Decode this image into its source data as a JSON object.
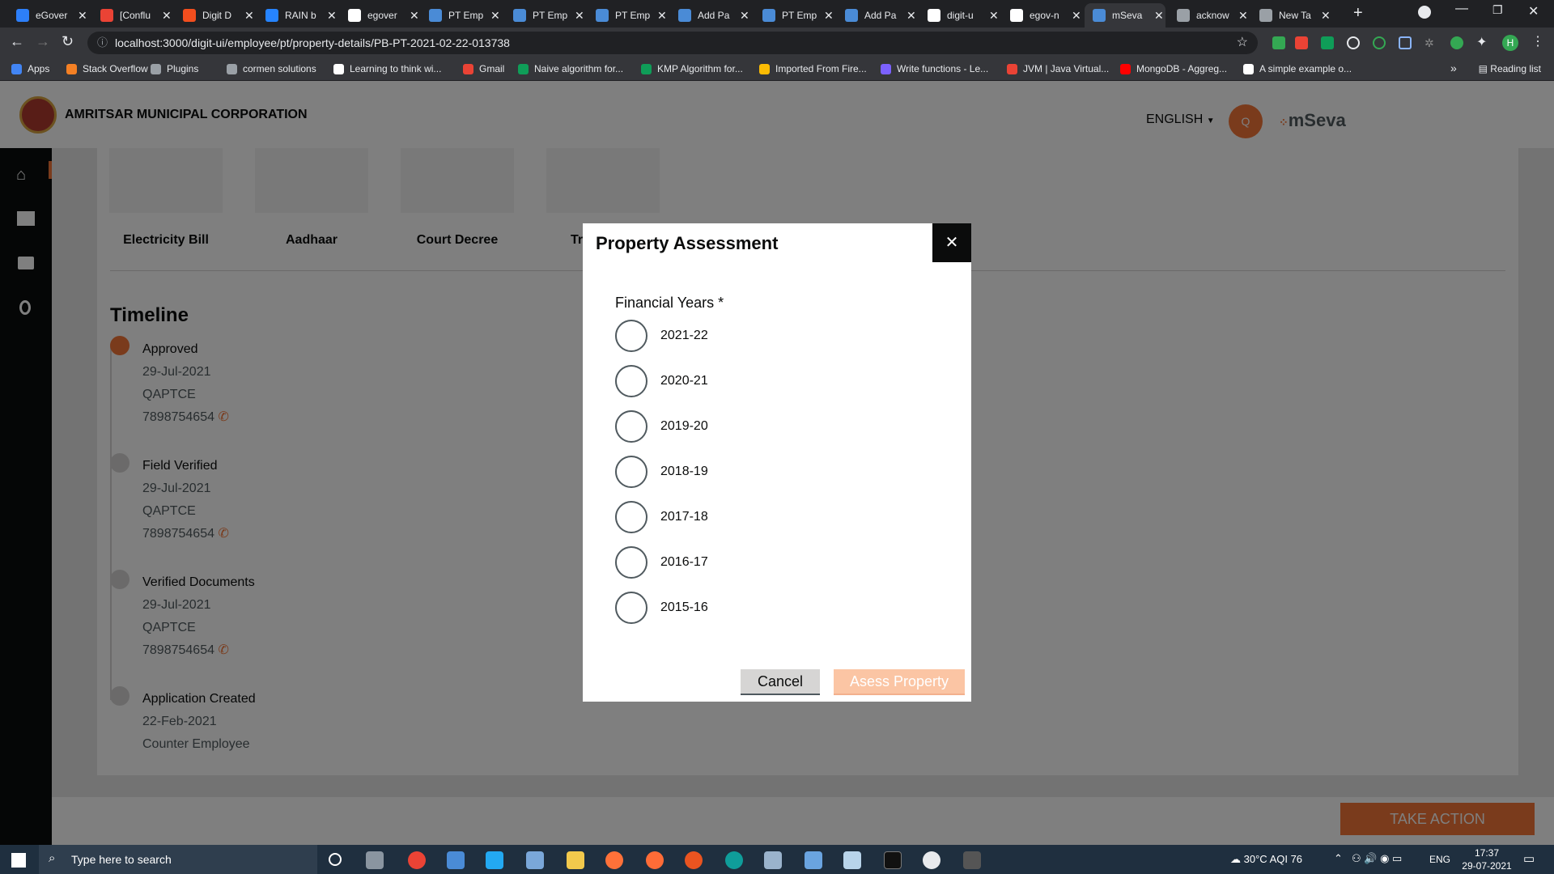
{
  "browser": {
    "tabs": [
      {
        "title": "eGover",
        "color": "#2d7ff9"
      },
      {
        "title": "[Conflu",
        "color": "#ea4335"
      },
      {
        "title": "Digit D",
        "color": "#f24e1e"
      },
      {
        "title": "RAIN b",
        "color": "#2684ff"
      },
      {
        "title": "egover",
        "color": "#ffffff"
      },
      {
        "title": "PT Emp",
        "color": "#4a8bd6"
      },
      {
        "title": "PT Emp",
        "color": "#4a8bd6"
      },
      {
        "title": "PT Emp",
        "color": "#4a8bd6"
      },
      {
        "title": "Add Pa",
        "color": "#4a8bd6"
      },
      {
        "title": "PT Emp",
        "color": "#4a8bd6"
      },
      {
        "title": "Add Pa",
        "color": "#4a8bd6"
      },
      {
        "title": "digit-u",
        "color": "#ffffff"
      },
      {
        "title": "egov-n",
        "color": "#ffffff"
      },
      {
        "title": "mSeva",
        "color": "#4a8bd6"
      },
      {
        "title": "acknow",
        "color": "#9aa0a6"
      },
      {
        "title": "New Ta",
        "color": "#9aa0a6"
      }
    ],
    "close_glyph": "✕",
    "new_tab_glyph": "+",
    "url": "localhost:3000/digit-ui/employee/pt/property-details/PB-PT-2021-02-22-013738",
    "bookmarks": [
      {
        "label": "Apps",
        "color": "#4285f4"
      },
      {
        "label": "Stack Overflow",
        "color": "#f48024"
      },
      {
        "label": "Plugins",
        "color": "#9aa0a6"
      },
      {
        "label": "cormen solutions",
        "color": "#9aa0a6"
      },
      {
        "label": "Learning to think wi...",
        "color": "#ffffff"
      },
      {
        "label": "Gmail",
        "color": "#ea4335"
      },
      {
        "label": "Naive algorithm for...",
        "color": "#0f9d58"
      },
      {
        "label": "KMP Algorithm for...",
        "color": "#0f9d58"
      },
      {
        "label": "Imported From Fire...",
        "color": "#fbbc04"
      },
      {
        "label": "Write functions - Le...",
        "color": "#7b61ff"
      },
      {
        "label": "JVM | Java Virtual...",
        "color": "#ea4335"
      },
      {
        "label": "MongoDB - Aggreg...",
        "color": "#ff0000"
      },
      {
        "label": "A simple example o...",
        "color": "#ffffff"
      }
    ],
    "overflow_glyph": "»",
    "reading_list": "Reading list"
  },
  "app": {
    "org_name": "AMRITSAR MUNICIPAL CORPORATION",
    "language": "ENGLISH",
    "avatar_initial": "Q",
    "brand": "mSeva",
    "accent": "#f47738",
    "documents": [
      "Electricity Bill",
      "Aadhaar",
      "Court Decree",
      "Tr"
    ],
    "timeline_title": "Timeline",
    "timeline": [
      {
        "status": "Approved",
        "date": "29-Jul-2021",
        "by": "QAPTCE",
        "phone": "7898754654"
      },
      {
        "status": "Field Verified",
        "date": "29-Jul-2021",
        "by": "QAPTCE",
        "phone": "7898754654"
      },
      {
        "status": "Verified Documents",
        "date": "29-Jul-2021",
        "by": "QAPTCE",
        "phone": "7898754654"
      },
      {
        "status": "Application Created",
        "date": "22-Feb-2021",
        "by": "Counter Employee",
        "phone": ""
      }
    ],
    "take_action": "TAKE ACTION"
  },
  "modal": {
    "title": "Property Assessment",
    "close_glyph": "✕",
    "field_label": "Financial Years *",
    "options": [
      "2021-22",
      "2020-21",
      "2019-20",
      "2018-19",
      "2017-18",
      "2016-17",
      "2015-16"
    ],
    "cancel_label": "Cancel",
    "submit_label": "Asess Property"
  },
  "taskbar": {
    "search_placeholder": "Type here to search",
    "weather": "30°C  AQI 76",
    "language": "ENG",
    "time": "17:37",
    "date": "29-07-2021"
  }
}
